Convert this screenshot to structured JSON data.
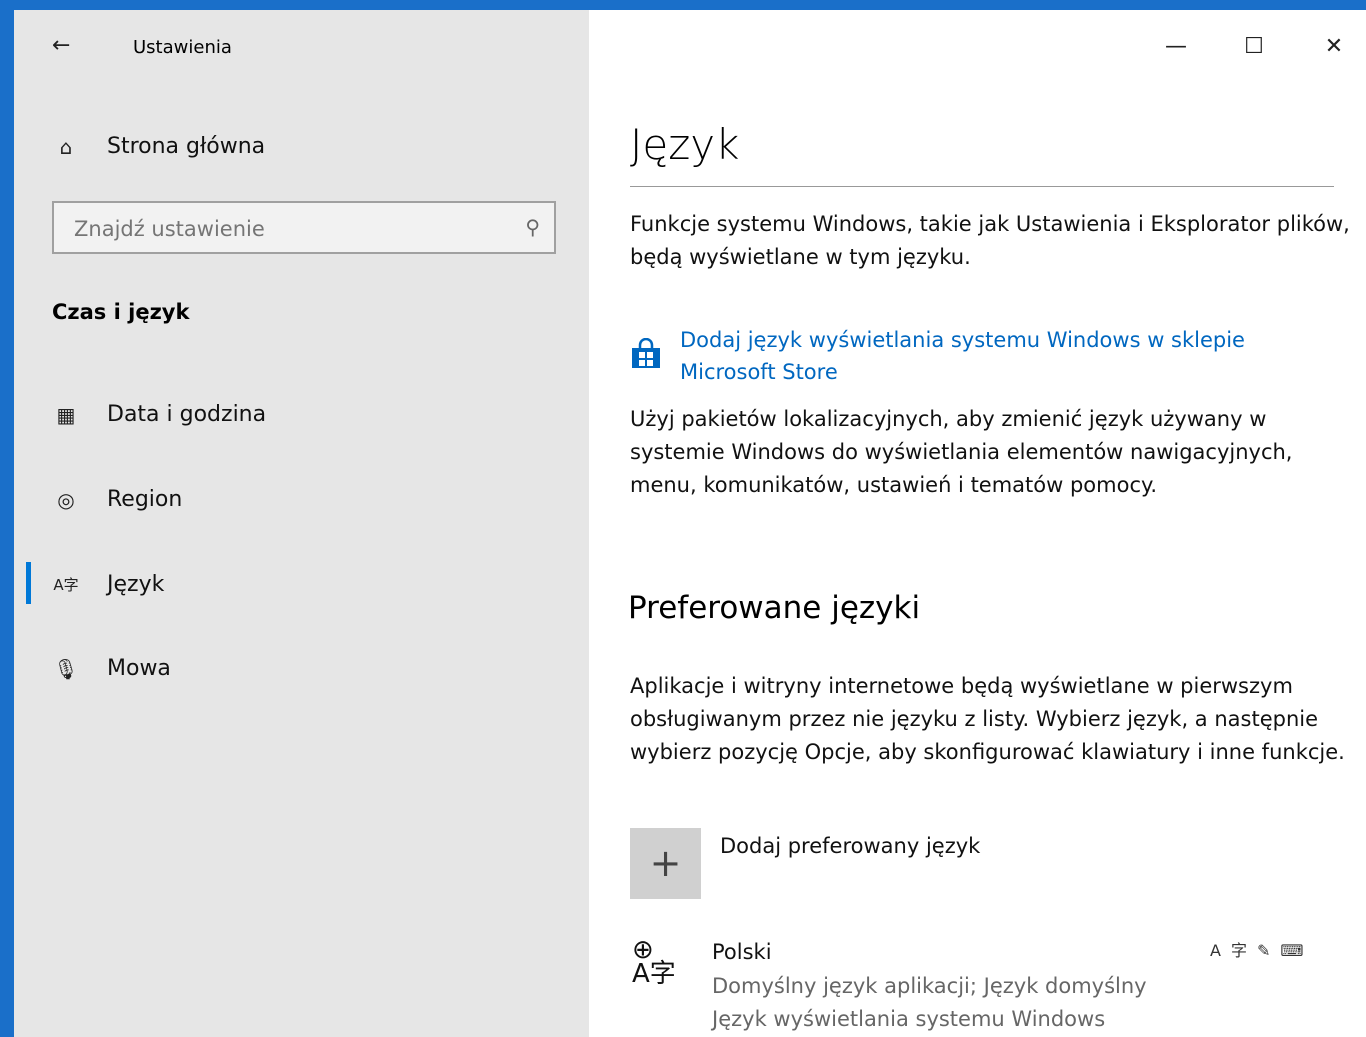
{
  "sidebar": {
    "app_title": "Ustawienia",
    "home_label": "Strona główna",
    "search_placeholder": "Znajdź ustawienie",
    "section_heading": "Czas i język",
    "items": [
      {
        "label": "Data i godzina",
        "icon": "calendar-clock-icon"
      },
      {
        "label": "Region",
        "icon": "globe-icon"
      },
      {
        "label": "Język",
        "icon": "language-icon",
        "selected": true
      },
      {
        "label": "Mowa",
        "icon": "microphone-icon"
      }
    ]
  },
  "window_controls": {
    "minimize": "—",
    "maximize": "☐",
    "close": "✕"
  },
  "main": {
    "title": "Język",
    "intro": "Funkcje systemu Windows, takie jak Ustawienia i Eksplorator plików, będą wyświetlane w tym języku.",
    "store_link": "Dodaj język wyświetlania systemu Windows w sklepie Microsoft Store",
    "store_desc": "Użyj pakietów lokalizacyjnych, aby zmienić język używany w systemie Windows do wyświetlania elementów nawigacyjnych, menu, komunikatów, ustawień i tematów pomocy.",
    "preferred_heading": "Preferowane języki",
    "preferred_desc": "Aplikacje i witryny internetowe będą wyświetlane w pierwszym obsługiwanym przez nie języku z listy. Wybierz język, a następnie wybierz pozycję Opcje, aby skonfigurować klawiatury i inne funkcje.",
    "add_language_label": "Dodaj preferowany język",
    "languages": [
      {
        "name": "Polski",
        "line1": "Domyślny język aplikacji; Język domyślny",
        "line2": "Język wyświetlania systemu Windows"
      }
    ]
  },
  "colors": {
    "accent": "#0078d7",
    "link": "#0067c0",
    "sidebar_bg": "#e6e6e6"
  }
}
